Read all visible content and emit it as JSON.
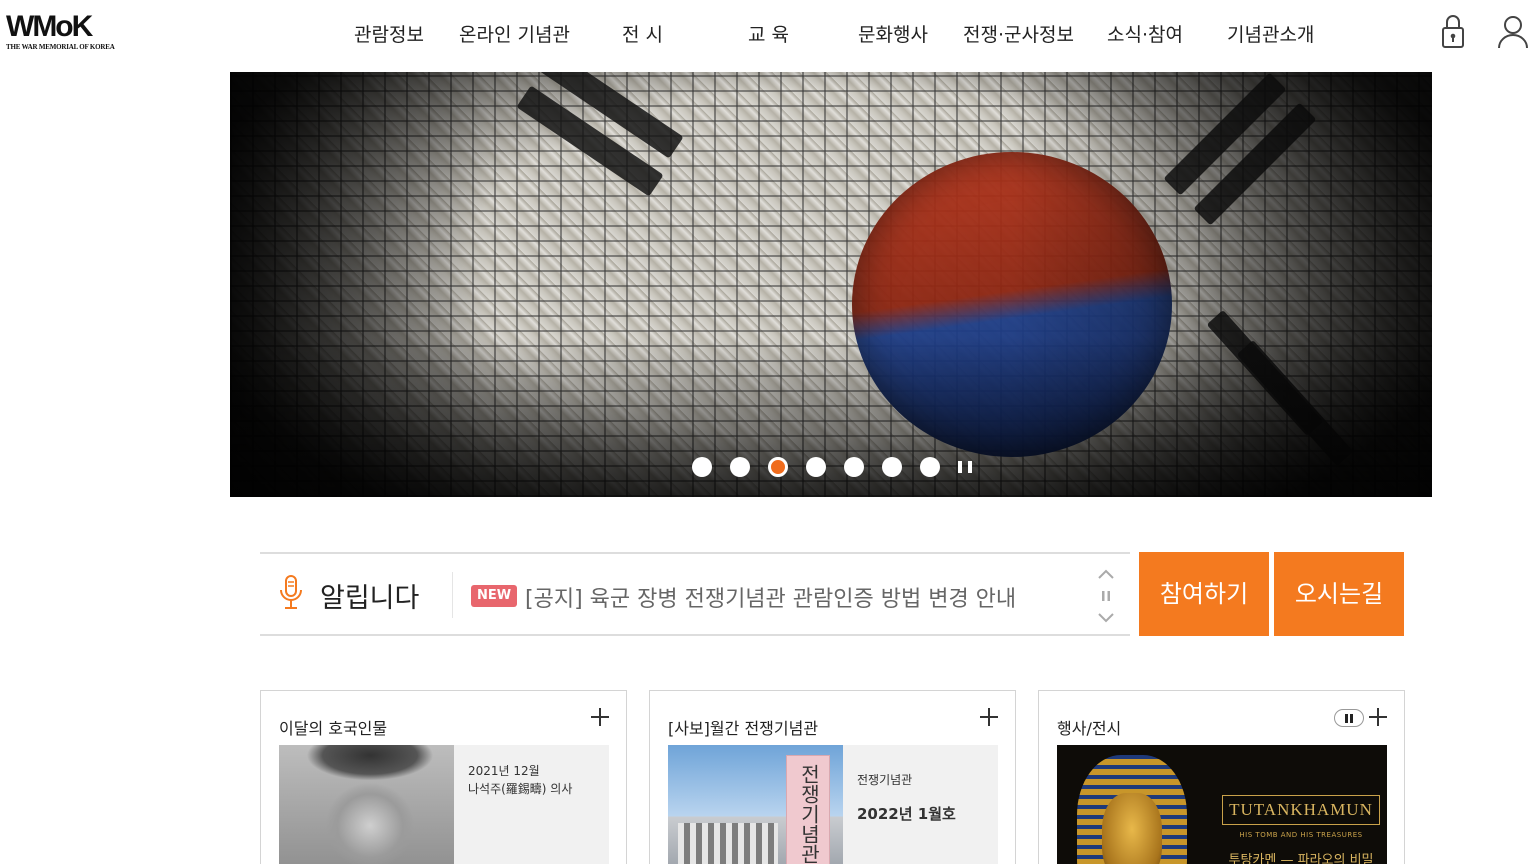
{
  "header": {
    "logo_text": "WMoK",
    "logo_sub": "THE WAR MEMORIAL OF KOREA",
    "nav": [
      "관람정보",
      "온라인 기념관",
      "전 시",
      "교 육",
      "문화행사",
      "전쟁·군사정보",
      "소식·참여",
      "기념관소개"
    ],
    "icons": [
      "lock-icon",
      "user-icon"
    ]
  },
  "hero": {
    "slide_count": 7,
    "active_slide": 3,
    "colors": {
      "active_dot": "#f06c1d",
      "dot": "#ffffff"
    }
  },
  "notice": {
    "title": "알립니다",
    "badge": "NEW",
    "text": "[공지] 육군 장병 전쟁기념관 관람인증 방법 변경 안내"
  },
  "buttons": {
    "participate": "참여하기",
    "directions": "오시는길",
    "color": "#f47a1f"
  },
  "cards": [
    {
      "title": "이달의 호국인물",
      "line1": "2021년 12월",
      "line2": "나석주(羅錫疇) 의사"
    },
    {
      "title": "[사보]월간 전쟁기념관",
      "line1": "전쟁기념관",
      "line2": "2022년 1월호",
      "cover_text": "전쟁기념관"
    },
    {
      "title": "행사/전시",
      "poster_title": "TUTANKHAMUN",
      "poster_sub": "HIS TOMB AND HIS TREASURES",
      "poster_ko": "투탕카멘 — 파라오의 비밀"
    }
  ]
}
